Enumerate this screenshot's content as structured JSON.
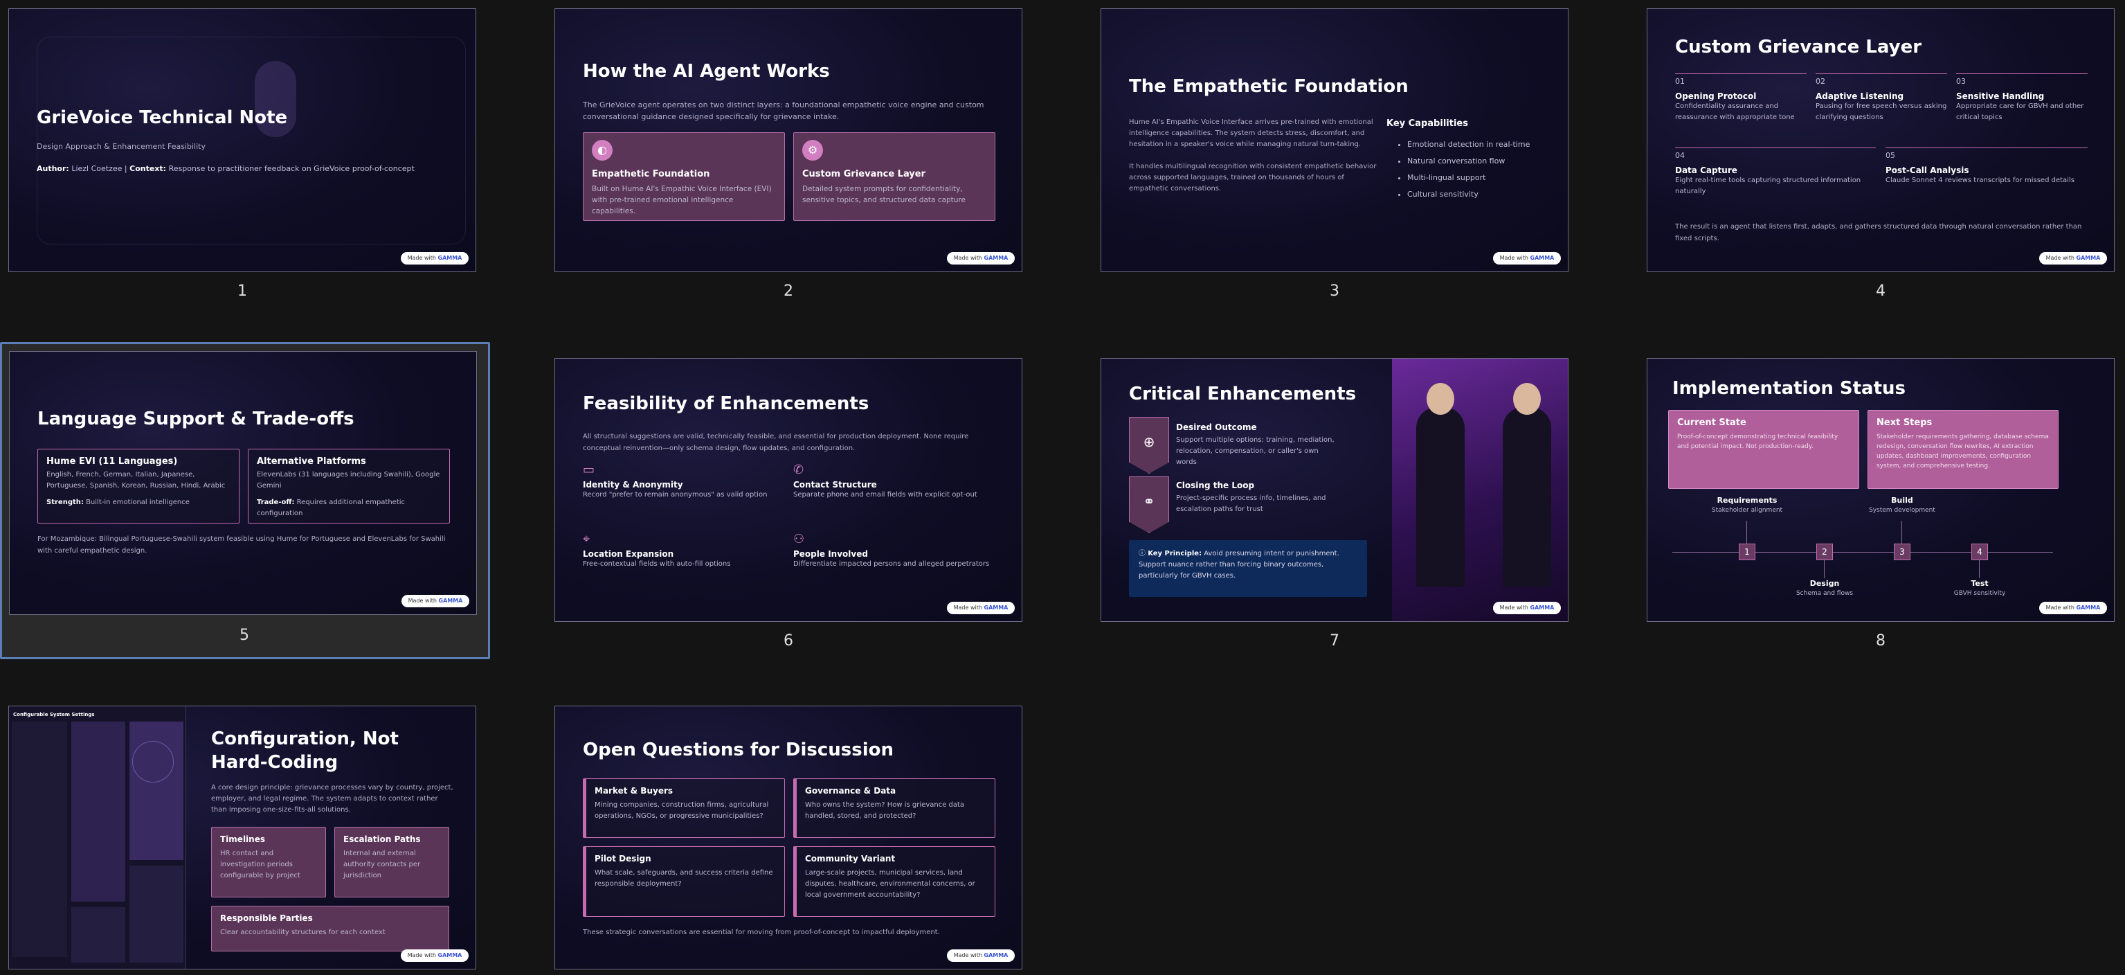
{
  "slides": [
    {
      "num": "1",
      "title": "GrieVoice Technical Note",
      "subtitle": "Design Approach & Enhancement Feasibility",
      "author_label": "Author:",
      "author": "Liezl Coetzee",
      "context_label": "Context:",
      "context": "Response to practitioner feedback on GrieVoice proof-of-concept",
      "made_with": "Made with",
      "brand": "GAMMA"
    },
    {
      "num": "2",
      "title": "How the AI Agent Works",
      "intro": "The GrieVoice agent operates on two distinct layers: a foundational empathetic voice engine and custom conversational guidance designed specifically for grievance intake.",
      "cards": [
        {
          "title": "Empathetic Foundation",
          "body": "Built on Hume AI's Empathic Voice Interface (EVI) with pre-trained emotional intelligence capabilities."
        },
        {
          "title": "Custom Grievance Layer",
          "body": "Detailed system prompts for confidentiality, sensitive topics, and structured data capture"
        }
      ],
      "made_with": "Made with",
      "brand": "GAMMA"
    },
    {
      "num": "3",
      "title": "The Empathetic Foundation",
      "p1": "Hume AI's Empathic Voice Interface arrives pre-trained with emotional intelligence capabilities. The system detects stress, discomfort, and hesitation in a speaker's voice while managing natural turn-taking.",
      "p2": "It handles multilingual recognition with consistent empathetic behavior across supported languages, trained on thousands of hours of empathetic conversations.",
      "cap_title": "Key Capabilities",
      "capabilities": [
        "Emotional detection in real-time",
        "Natural conversation flow",
        "Multi-lingual support",
        "Cultural sensitivity"
      ],
      "made_with": "Made with",
      "brand": "GAMMA"
    },
    {
      "num": "4",
      "title": "Custom Grievance Layer",
      "items": [
        {
          "n": "01",
          "title": "Opening Protocol",
          "body": "Confidentiality assurance and reassurance with appropriate tone"
        },
        {
          "n": "02",
          "title": "Adaptive Listening",
          "body": "Pausing for free speech versus asking clarifying questions"
        },
        {
          "n": "03",
          "title": "Sensitive Handling",
          "body": "Appropriate care for GBVH and other critical topics"
        },
        {
          "n": "04",
          "title": "Data Capture",
          "body": "Eight real-time tools capturing structured information naturally"
        },
        {
          "n": "05",
          "title": "Post-Call Analysis",
          "body": "Claude Sonnet 4 reviews transcripts for missed details"
        }
      ],
      "footer": "The result is an agent that listens first, adapts, and gathers structured data through natural conversation rather than fixed scripts.",
      "made_with": "Made with",
      "brand": "GAMMA"
    },
    {
      "num": "5",
      "title": "Language Support & Trade-offs",
      "cards": [
        {
          "title": "Hume EVI (11 Languages)",
          "body": "English, French, German, Italian, Japanese, Portuguese, Spanish, Korean, Russian, Hindi, Arabic",
          "label": "Strength:",
          "value": "Built-in emotional intelligence"
        },
        {
          "title": "Alternative Platforms",
          "body": "ElevenLabs (31 languages including Swahili), Google Gemini",
          "label": "Trade-off:",
          "value": "Requires additional empathetic configuration"
        }
      ],
      "footer": "For Mozambique: Bilingual Portuguese-Swahili system feasible using Hume for Portuguese and ElevenLabs for Swahili with careful empathetic design.",
      "made_with": "Made with",
      "brand": "GAMMA"
    },
    {
      "num": "6",
      "title": "Feasibility of Enhancements",
      "intro": "All structural suggestions are valid, technically feasible, and essential for production deployment. None require conceptual reinvention—only schema design, flow updates, and configuration.",
      "items": [
        {
          "title": "Identity & Anonymity",
          "body": "Record \"prefer to remain anonymous\" as valid option"
        },
        {
          "title": "Contact Structure",
          "body": "Separate phone and email fields with explicit opt-out"
        },
        {
          "title": "Location Expansion",
          "body": "Free-contextual fields with auto-fill options"
        },
        {
          "title": "People Involved",
          "body": "Differentiate impacted persons and alleged perpetrators"
        }
      ],
      "made_with": "Made with",
      "brand": "GAMMA"
    },
    {
      "num": "7",
      "title": "Critical Enhancements",
      "items": [
        {
          "title": "Desired Outcome",
          "body": "Support multiple options: training, mediation, relocation, compensation, or caller's own words"
        },
        {
          "title": "Closing the Loop",
          "body": "Project-specific process info, timelines, and escalation paths for trust"
        }
      ],
      "key_label": "Key Principle:",
      "key_text": "Avoid presuming intent or punishment. Support nuance rather than forcing binary outcomes, particularly for GBVH cases.",
      "made_with": "Made with",
      "brand": "GAMMA"
    },
    {
      "num": "8",
      "title": "Implementation Status",
      "cards": [
        {
          "title": "Current State",
          "body": "Proof-of-concept demonstrating technical feasibility and potential impact. Not production-ready."
        },
        {
          "title": "Next Steps",
          "body": "Stakeholder requirements gathering, database schema redesign, conversation flow rewrites, AI extraction updates, dashboard improvements, configuration system, and comprehensive testing."
        }
      ],
      "timeline": [
        {
          "n": "1",
          "title": "Requirements",
          "sub": "Stakeholder alignment",
          "pos": "top"
        },
        {
          "n": "2",
          "title": "Design",
          "sub": "Schema and flows",
          "pos": "bottom"
        },
        {
          "n": "3",
          "title": "Build",
          "sub": "System development",
          "pos": "top"
        },
        {
          "n": "4",
          "title": "Test",
          "sub": "GBVH sensitivity",
          "pos": "bottom"
        }
      ],
      "made_with": "Made with",
      "brand": "GAMMA"
    },
    {
      "num": "9",
      "title": "Configuration, Not Hard-Coding",
      "intro": "A core design principle: grievance processes vary by country, project, employer, and legal regime. The system adapts to context rather than imposing one-size-fits-all solutions.",
      "cards": [
        {
          "title": "Timelines",
          "body": "HR contact and investigation periods configurable by project"
        },
        {
          "title": "Escalation Paths",
          "body": "Internal and external authority contacts per jurisdiction"
        },
        {
          "title": "Responsible Parties",
          "body": "Clear accountability structures for each context"
        }
      ],
      "panel_title": "Configurable System Settings",
      "made_with": "Made with",
      "brand": "GAMMA"
    },
    {
      "num": "10",
      "title": "Open Questions for Discussion",
      "cards": [
        {
          "title": "Market & Buyers",
          "body": "Mining companies, construction firms, agricultural operations, NGOs, or progressive municipalities?"
        },
        {
          "title": "Governance & Data",
          "body": "Who owns the system? How is grievance data handled, stored, and protected?"
        },
        {
          "title": "Pilot Design",
          "body": "What scale, safeguards, and success criteria define responsible deployment?"
        },
        {
          "title": "Community Variant",
          "body": "Large-scale projects, municipal services, land disputes, healthcare, environmental concerns, or local government accountability?"
        }
      ],
      "footer": "These strategic conversations are essential for moving from proof-of-concept to impactful deployment.",
      "made_with": "Made with",
      "brand": "GAMMA"
    }
  ]
}
